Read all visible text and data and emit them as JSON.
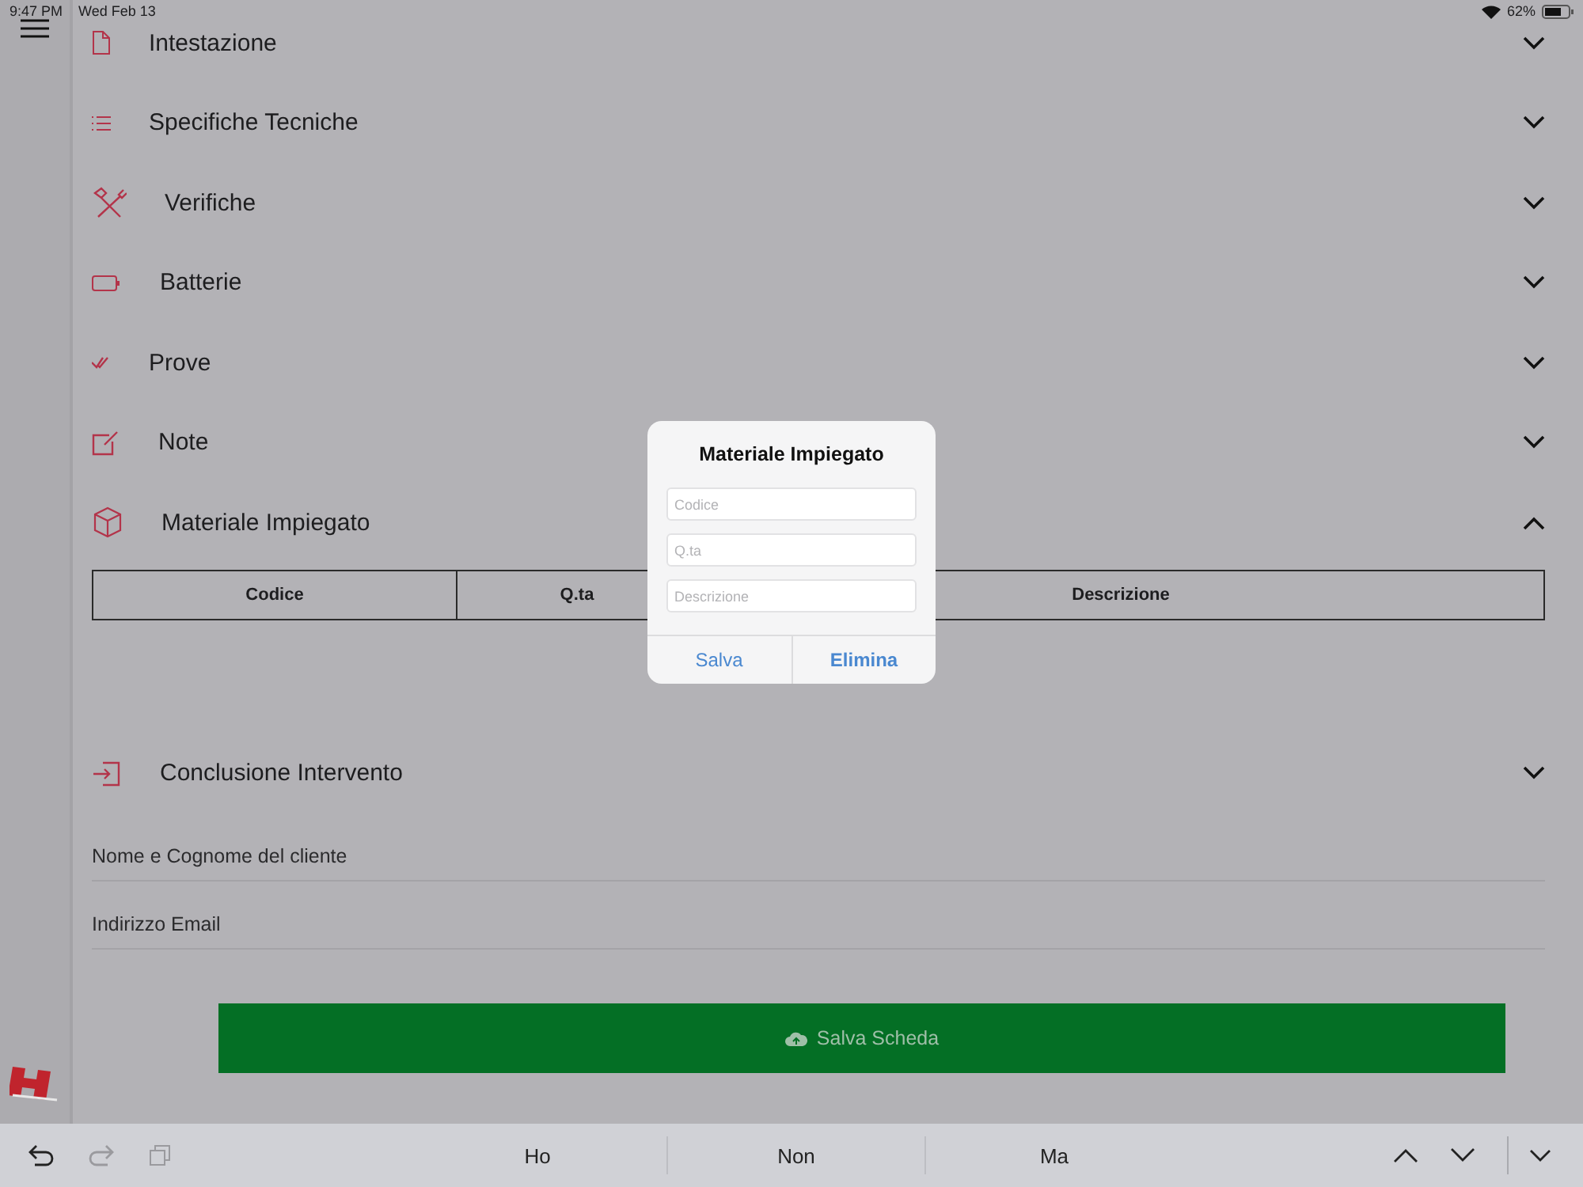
{
  "status_bar": {
    "time": "9:47 PM",
    "date": "Wed Feb 13",
    "battery": "62%"
  },
  "sections": [
    {
      "title": "Intestazione",
      "expanded": false
    },
    {
      "title": "Specifiche Tecniche",
      "expanded": false
    },
    {
      "title": "Verifiche",
      "expanded": false
    },
    {
      "title": "Batterie",
      "expanded": false
    },
    {
      "title": "Prove",
      "expanded": false
    },
    {
      "title": "Note",
      "expanded": false
    },
    {
      "title": "Materiale Impiegato",
      "expanded": true,
      "table": {
        "columns": [
          "Codice",
          "Q.ta",
          "Descrizione"
        ]
      }
    },
    {
      "title": "Conclusione Intervento",
      "expanded": false
    }
  ],
  "fields": [
    {
      "placeholder": "Nome e Cognome del cliente"
    },
    {
      "placeholder": "Indirizzo Email"
    }
  ],
  "save_button": "Salva Scheda",
  "dialog": {
    "title": "Materiale Impiegato",
    "fields": [
      {
        "placeholder": "Codice"
      },
      {
        "placeholder": "Q.ta"
      },
      {
        "placeholder": "Descrizione"
      }
    ],
    "buttons": [
      "Salva",
      "Elimina"
    ]
  },
  "keyboard_bar": {
    "suggestions": [
      "Ho",
      "Non",
      "Ma"
    ]
  }
}
